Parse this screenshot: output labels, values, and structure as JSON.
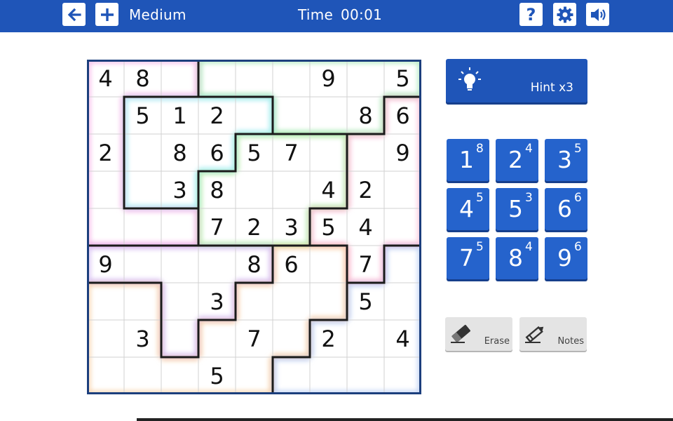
{
  "header": {
    "difficulty": "Medium",
    "time_label": "Time",
    "time_value": "00:01",
    "help_label": "?"
  },
  "icons": {
    "back": "arrow-left-icon",
    "new_game": "plus-icon",
    "help": "question-icon",
    "settings": "gear-icon",
    "sound": "speaker-icon",
    "hint": "lightbulb-icon",
    "erase": "eraser-icon",
    "notes": "pencil-icon"
  },
  "colors": {
    "brand": "#1f55b8",
    "number_button": "#2563cc",
    "tool_button": "#e4e4e4"
  },
  "hint": {
    "label": "Hint x3"
  },
  "board": {
    "size": 9,
    "cells": [
      [
        "4",
        "8",
        "",
        "",
        "",
        "",
        "9",
        "",
        "5"
      ],
      [
        "",
        "5",
        "1",
        "2",
        "",
        "",
        "",
        "8",
        "6"
      ],
      [
        "2",
        "",
        "8",
        "6",
        "5",
        "7",
        "",
        "",
        "9"
      ],
      [
        "",
        "",
        "3",
        "8",
        "",
        "",
        "4",
        "2",
        ""
      ],
      [
        "",
        "",
        "",
        "7",
        "2",
        "3",
        "5",
        "4",
        ""
      ],
      [
        "9",
        "",
        "",
        "",
        "8",
        "6",
        "",
        "7",
        ""
      ],
      [
        "",
        "",
        "",
        "3",
        "",
        "",
        "",
        "5",
        ""
      ],
      [
        "",
        "3",
        "",
        "",
        "7",
        "",
        "2",
        "",
        "4"
      ],
      [
        "",
        "",
        "",
        "5",
        "",
        "",
        "",
        "",
        ""
      ]
    ],
    "regions": [
      [
        1,
        1,
        1,
        2,
        2,
        2,
        2,
        2,
        2
      ],
      [
        1,
        3,
        3,
        3,
        3,
        2,
        2,
        2,
        4
      ],
      [
        1,
        3,
        3,
        3,
        5,
        5,
        5,
        4,
        4
      ],
      [
        1,
        3,
        3,
        5,
        5,
        5,
        5,
        4,
        4
      ],
      [
        1,
        1,
        1,
        5,
        5,
        5,
        4,
        4,
        4
      ],
      [
        6,
        6,
        6,
        6,
        6,
        7,
        7,
        4,
        8
      ],
      [
        7,
        7,
        6,
        6,
        7,
        7,
        7,
        8,
        8
      ],
      [
        7,
        7,
        6,
        7,
        7,
        7,
        8,
        8,
        8
      ],
      [
        7,
        7,
        7,
        7,
        7,
        8,
        8,
        8,
        8
      ]
    ],
    "region_colors": {
      "1": "#f5b3e8",
      "2": "#a8e8b8",
      "3": "#a8eef5",
      "4": "#f9b9d4",
      "5": "#b5ecaa",
      "6": "#d3b9f2",
      "7": "#f8cfa4",
      "8": "#b7ccf3"
    }
  },
  "number_pad": [
    {
      "digit": "1",
      "count": "8"
    },
    {
      "digit": "2",
      "count": "4"
    },
    {
      "digit": "3",
      "count": "5"
    },
    {
      "digit": "4",
      "count": "5"
    },
    {
      "digit": "5",
      "count": "3"
    },
    {
      "digit": "6",
      "count": "6"
    },
    {
      "digit": "7",
      "count": "5"
    },
    {
      "digit": "8",
      "count": "4"
    },
    {
      "digit": "9",
      "count": "6"
    }
  ],
  "tools": {
    "erase_label": "Erase",
    "notes_label": "Notes"
  }
}
